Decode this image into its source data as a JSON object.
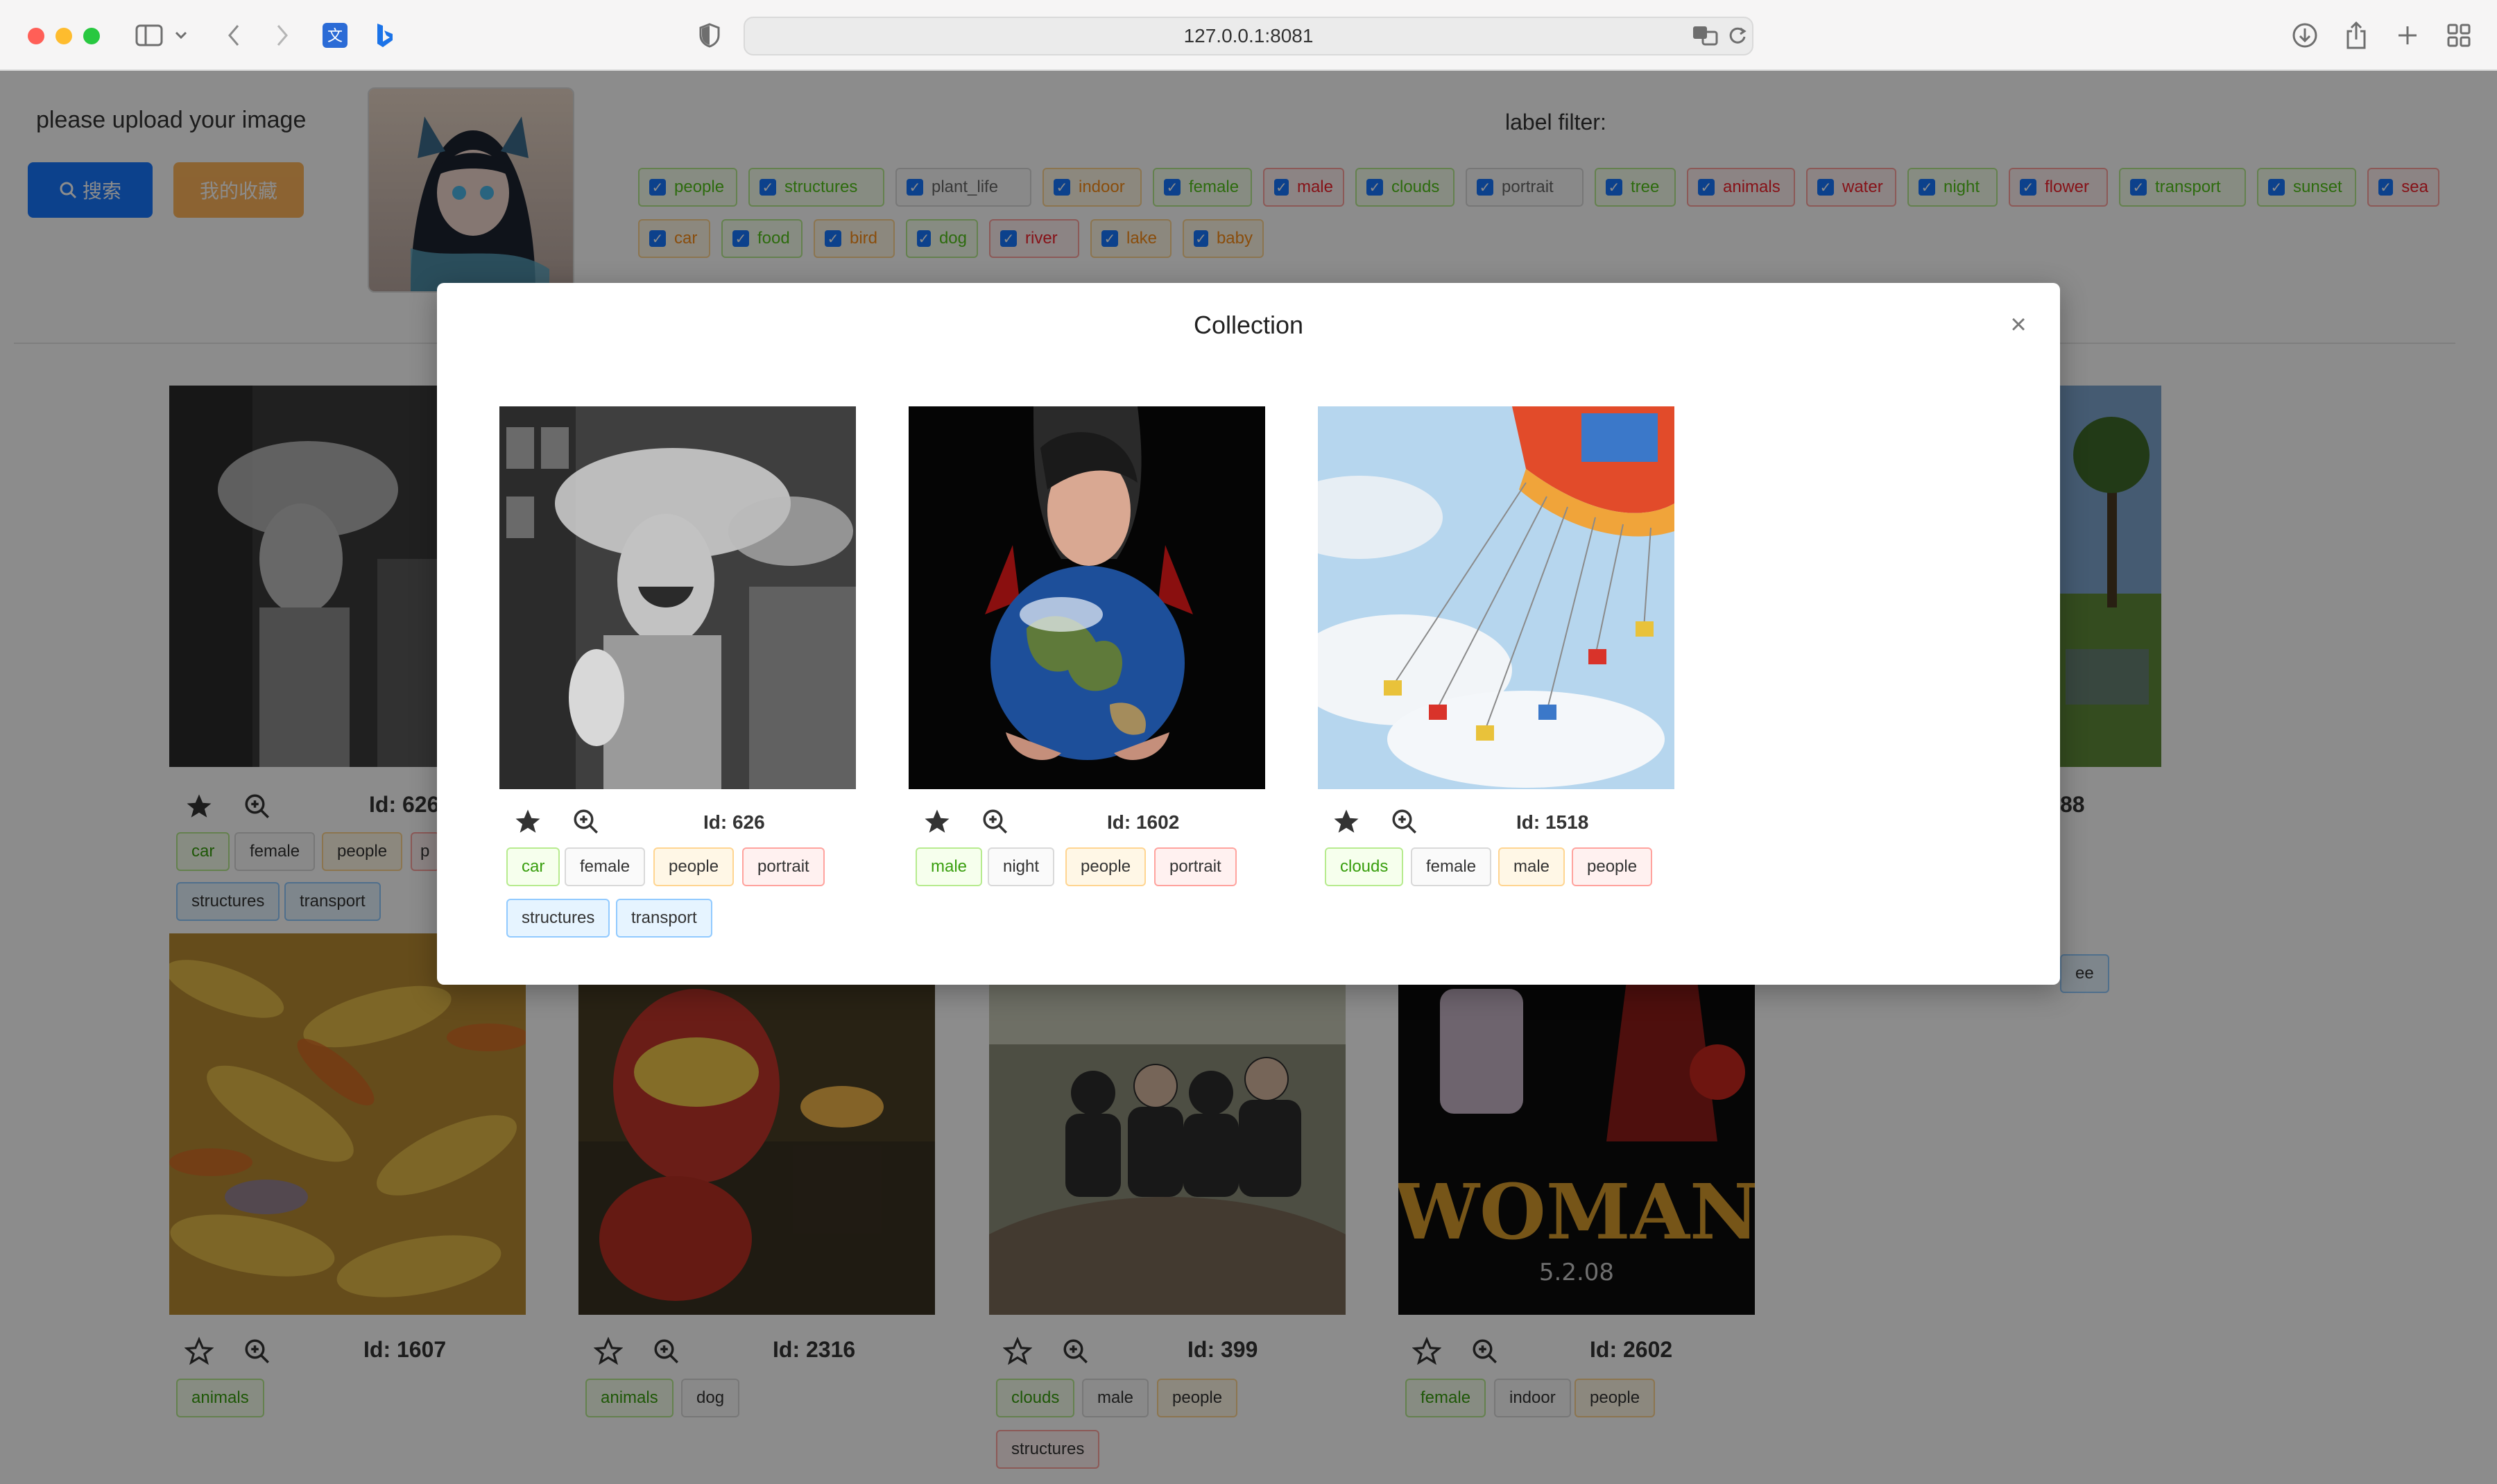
{
  "browser": {
    "url": "127.0.0.1:8081"
  },
  "header": {
    "upload_label": "please upload your image",
    "search_button": "搜索",
    "favorites_button": "我的收藏",
    "filter_title": "label filter:"
  },
  "filters": [
    {
      "label": "people",
      "color": "green"
    },
    {
      "label": "structures",
      "color": "green"
    },
    {
      "label": "plant_life",
      "color": "gray"
    },
    {
      "label": "indoor",
      "color": "orange"
    },
    {
      "label": "female",
      "color": "green"
    },
    {
      "label": "male",
      "color": "red"
    },
    {
      "label": "clouds",
      "color": "green"
    },
    {
      "label": "portrait",
      "color": "gray"
    },
    {
      "label": "tree",
      "color": "green"
    },
    {
      "label": "animals",
      "color": "red"
    },
    {
      "label": "water",
      "color": "red"
    },
    {
      "label": "night",
      "color": "green"
    },
    {
      "label": "flower",
      "color": "red"
    },
    {
      "label": "transport",
      "color": "green"
    },
    {
      "label": "sunset",
      "color": "green"
    },
    {
      "label": "sea",
      "color": "red"
    },
    {
      "label": "car",
      "color": "orange"
    },
    {
      "label": "food",
      "color": "green"
    },
    {
      "label": "bird",
      "color": "orange"
    },
    {
      "label": "dog",
      "color": "green"
    },
    {
      "label": "river",
      "color": "red"
    },
    {
      "label": "lake",
      "color": "orange"
    },
    {
      "label": "baby",
      "color": "orange"
    }
  ],
  "gallery": {
    "row1": [
      {
        "id_label": "Id: 626",
        "tags": [
          "car",
          "female",
          "people",
          "p"
        ],
        "tags2": [
          "structures",
          "transport"
        ]
      },
      {
        "id_label": "88",
        "tags": [],
        "tags2": [
          "ee"
        ]
      }
    ],
    "row2": [
      {
        "id_label": "Id: 1607",
        "tags": [
          "animals"
        ]
      },
      {
        "id_label": "Id: 2316",
        "tags": [
          "animals",
          "dog"
        ]
      },
      {
        "id_label": "Id: 399",
        "tags": [
          "clouds",
          "male",
          "people"
        ],
        "tags2": [
          "structures"
        ]
      },
      {
        "id_label": "Id: 2602",
        "tags": [
          "female",
          "indoor",
          "people"
        ]
      }
    ]
  },
  "modal": {
    "title": "Collection",
    "close_icon": "close-icon",
    "items": [
      {
        "id_label": "Id: 626",
        "tags": [
          "car",
          "female",
          "people",
          "portrait"
        ],
        "tags2": [
          "structures",
          "transport"
        ]
      },
      {
        "id_label": "Id: 1602",
        "tags": [
          "male",
          "night",
          "people",
          "portrait"
        ]
      },
      {
        "id_label": "Id: 1518",
        "tags": [
          "clouds",
          "female",
          "male",
          "people"
        ]
      }
    ]
  }
}
